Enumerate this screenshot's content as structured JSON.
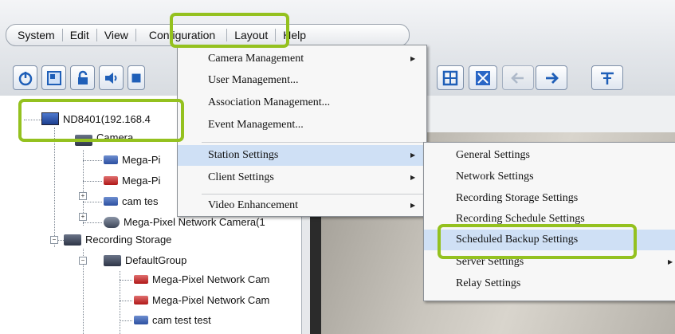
{
  "menubar": {
    "items": [
      "System",
      "Edit",
      "View",
      "Configuration",
      "Layout",
      "Help"
    ]
  },
  "toolbar": {
    "left_icons": [
      "power-icon",
      "layout-switch-icon",
      "lock-icon",
      "speaker-icon"
    ],
    "right_icons": [
      "grid-icon",
      "fullscreen-icon",
      "back-arrow-icon",
      "forward-arrow-icon",
      "pin-icon"
    ]
  },
  "tree": {
    "root": "ND8401(192.168.4",
    "camera_group": "Camera",
    "camera_items": [
      "Mega-Pi",
      "Mega-Pi",
      "cam tes",
      "Mega-Pixel Network Camera(1"
    ],
    "recording_storage": "Recording Storage",
    "default_group": "DefaultGroup",
    "storage_items": [
      "Mega-Pixel Network Cam",
      "Mega-Pixel Network Cam",
      "cam test test"
    ]
  },
  "config_menu": {
    "items": [
      "Camera Management",
      "User Management...",
      "Association Management...",
      "Event Management...",
      "Station Settings",
      "Client Settings",
      "Video Enhancement"
    ]
  },
  "station_submenu": {
    "items": [
      "General Settings",
      "Network Settings",
      "Recording Storage Settings",
      "Recording Schedule Settings",
      "Scheduled Backup Settings",
      "Server Settings",
      "Relay Settings"
    ]
  },
  "colors": {
    "highlight_green": "#94c11f",
    "menu_highlight": "#cfe0f5"
  }
}
